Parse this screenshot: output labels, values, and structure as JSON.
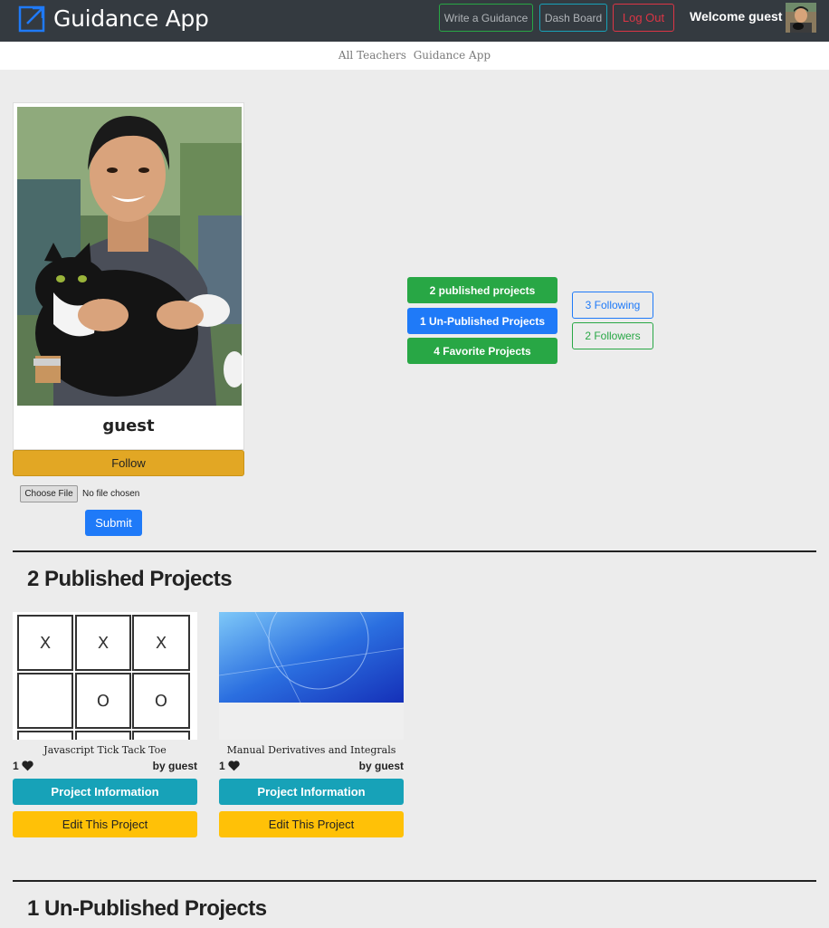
{
  "navbar": {
    "brand": "Guidance App",
    "buttons": {
      "write": "Write a Guidance",
      "dashboard": "Dash Board",
      "logout": "Log Out"
    },
    "welcome": "Welcome guest"
  },
  "subnav": {
    "link1": "All Teachers",
    "link2": "Guidance App"
  },
  "profile": {
    "name": "guest",
    "follow_label": "Follow",
    "file_button": "Choose File",
    "file_status": "No file chosen",
    "submit_label": "Submit"
  },
  "stats": {
    "published": "2 published projects",
    "unpublished": "1 Un-Published Projects",
    "favorite": "4 Favorite Projects",
    "following": "3 Following",
    "followers": "2 Followers"
  },
  "published_section": {
    "title": "2 Published Projects",
    "projects": [
      {
        "title": "Javascript Tick Tack Toe",
        "likes": "1",
        "author": "by guest",
        "info_label": "Project Information",
        "edit_label": "Edit This Project",
        "board": [
          "X",
          "X",
          "X",
          "",
          "O",
          "O"
        ]
      },
      {
        "title": "Manual Derivatives and Integrals",
        "likes": "1",
        "author": "by guest",
        "info_label": "Project Information",
        "edit_label": "Edit This Project"
      }
    ]
  },
  "unpublished_section": {
    "title": "1 Un-Published Projects"
  },
  "colors": {
    "navbar": "#343a40",
    "primary": "#1f7af8",
    "success": "#28a745",
    "info": "#17a2b8",
    "warning": "#ffc107",
    "danger": "#dc3545",
    "follow": "#e2a724"
  },
  "icons": {
    "brand": "external-link-icon",
    "like": "heart-icon"
  }
}
